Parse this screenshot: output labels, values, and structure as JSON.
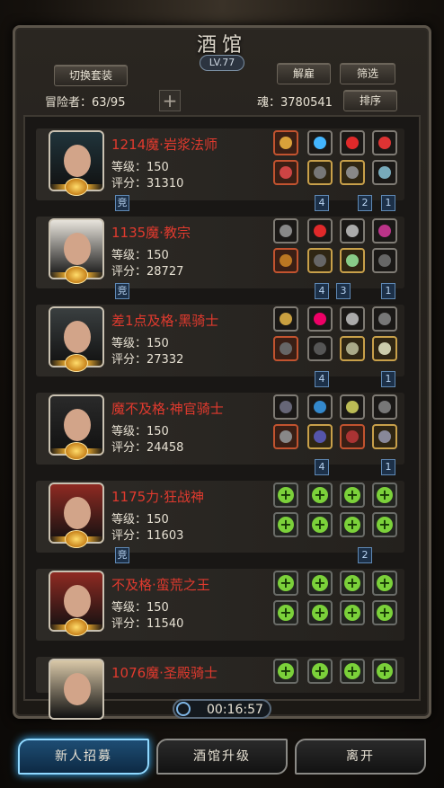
{
  "header": {
    "title": "酒馆",
    "level": "LV.77",
    "switch_set_label": "切换套装",
    "dismiss_label": "解雇",
    "filter_label": "筛选",
    "sort_label": "排序",
    "adventurers": "冒险者：63/95",
    "soul": "魂：3780541"
  },
  "heroes": [
    {
      "name": "1214魔·岩浆法师",
      "level": "等级：150",
      "score": "评分：31310"
    },
    {
      "name": "1135魔·教宗",
      "level": "等级：150",
      "score": "评分：28727"
    },
    {
      "name": "差1点及格·黑骑士",
      "level": "等级：150",
      "score": "评分：27332"
    },
    {
      "name": "魔不及格·神官骑士",
      "level": "等级：150",
      "score": "评分：24458"
    },
    {
      "name": "1175力·狂战神",
      "level": "等级：150",
      "score": "评分：11603"
    },
    {
      "name": "不及格·蛮荒之王",
      "level": "等级：150",
      "score": "评分：11540"
    },
    {
      "name": "1076魔·圣殿骑士",
      "level": "",
      "score": ""
    }
  ],
  "tags": {
    "jing": "竞",
    "four": "4",
    "three": "3",
    "two": "2",
    "one": "1"
  },
  "footer": {
    "timer": "00:16:57",
    "recruit_label": "新人招募",
    "upgrade_label": "酒馆升级",
    "leave_label": "离开"
  },
  "colors": {
    "hero_name": "#e03a2e",
    "accent_blue": "#3ab3ff",
    "plus_green": "#7bd13a"
  }
}
